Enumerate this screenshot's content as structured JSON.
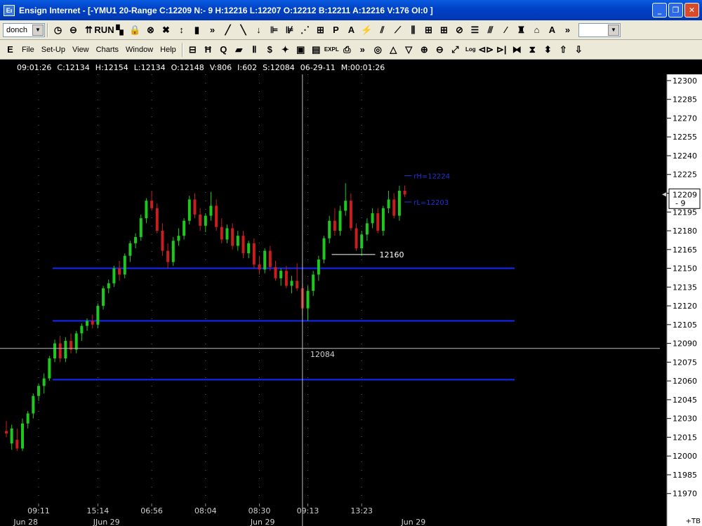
{
  "window": {
    "title": "Ensign Internet - [-YMU1 20-Range C:12209 N:- 9 H:12216 L:12207 O:12212 B:12211 A:12216 V:176 OI:0 ]",
    "minimize": "_",
    "maximize": "❐",
    "close": "✕"
  },
  "toolbar1": {
    "study_combo": "donch",
    "icons": [
      "◷",
      "⊖",
      "⇈",
      "RUN",
      "▚",
      "🔒",
      "⊗",
      "✖",
      "↕",
      "▮",
      "»",
      "╱",
      "╲",
      "↓",
      "⊫",
      "⊯",
      "⋰",
      "⊞",
      "P",
      "A",
      "⚡",
      "⫽",
      "⟋",
      "⫼",
      "⊞",
      "⊞",
      "⊘",
      "☰",
      "⫻",
      "⁄",
      "♜",
      "⌂",
      "A",
      "»"
    ],
    "right_combo": ""
  },
  "toolbar2": {
    "menus": [
      "File",
      "Set-Up",
      "View",
      "Charts",
      "Window",
      "Help"
    ],
    "icons": [
      "⊟",
      "Ħ",
      "Q",
      "▰",
      "Ⅱ",
      "$",
      "✦",
      "▣",
      "▤",
      "EXPL",
      "⎙",
      "»",
      "◎",
      "△",
      "▽",
      "⊕",
      "⊖",
      "⤢",
      "Log",
      "⊲⊳",
      "⊳|",
      "⧓",
      "⧗",
      "⬍",
      "⇧",
      "⇩"
    ]
  },
  "status": {
    "time": "09:01:26",
    "close": "C:12134",
    "high": "H:12154",
    "low": "L:12134",
    "open": "O:12148",
    "volume": "V:806",
    "interval": "I:602",
    "s": "S:12084",
    "date": "06-29-11",
    "m": "M:00:01:26"
  },
  "colors": {
    "up": "#1ec81e",
    "down": "#c81e1e",
    "hline": "#1428ff",
    "grid": "#6a6a6a",
    "label_blue": "#2233dd"
  },
  "chart_data": {
    "type": "candlestick",
    "title": "",
    "ylim": [
      11962,
      12305
    ],
    "y_ticks": [
      12300,
      12285,
      12270,
      12255,
      12240,
      12225,
      12210,
      12195,
      12180,
      12165,
      12150,
      12135,
      12120,
      12105,
      12090,
      12075,
      12060,
      12045,
      12030,
      12015,
      12000,
      11985,
      11970
    ],
    "x_ticks": [
      {
        "label": "09:11",
        "bar": 6
      },
      {
        "label": "15:14",
        "bar": 17
      },
      {
        "label": "06:56",
        "bar": 27
      },
      {
        "label": "08:04",
        "bar": 37
      },
      {
        "label": "08:30",
        "bar": 47
      },
      {
        "label": "09:13",
        "bar": 56
      },
      {
        "label": "13:23",
        "bar": 66
      }
    ],
    "date_labels": [
      {
        "label": "Jun 28",
        "bar": 4
      },
      {
        "label": "JJun 29",
        "bar": 19
      },
      {
        "label": "Jun 29",
        "bar": 48
      },
      {
        "label": "Jun 29",
        "bar": 76
      }
    ],
    "candles": [
      [
        12020,
        12028,
        12015,
        12018
      ],
      [
        12010,
        12025,
        12005,
        12022
      ],
      [
        12013,
        12022,
        12004,
        12006
      ],
      [
        12006,
        12030,
        12004,
        12026
      ],
      [
        12026,
        12036,
        12022,
        12034
      ],
      [
        12034,
        12050,
        12030,
        12048
      ],
      [
        12048,
        12058,
        12044,
        12056
      ],
      [
        12056,
        12066,
        12050,
        12062
      ],
      [
        12062,
        12080,
        12060,
        12078
      ],
      [
        12078,
        12093,
        12075,
        12090
      ],
      [
        12090,
        12096,
        12075,
        12078
      ],
      [
        12078,
        12095,
        12075,
        12092
      ],
      [
        12092,
        12098,
        12082,
        12085
      ],
      [
        12085,
        12100,
        12082,
        12098
      ],
      [
        12098,
        12106,
        12092,
        12104
      ],
      [
        12104,
        12110,
        12100,
        12108
      ],
      [
        12108,
        12113,
        12102,
        12105
      ],
      [
        12105,
        12122,
        12102,
        12120
      ],
      [
        12120,
        12136,
        12117,
        12134
      ],
      [
        12134,
        12141,
        12130,
        12138
      ],
      [
        12138,
        12152,
        12135,
        12150
      ],
      [
        12150,
        12156,
        12140,
        12145
      ],
      [
        12145,
        12162,
        12142,
        12160
      ],
      [
        12160,
        12172,
        12155,
        12170
      ],
      [
        12170,
        12178,
        12166,
        12175
      ],
      [
        12175,
        12193,
        12172,
        12190
      ],
      [
        12190,
        12206,
        12186,
        12204
      ],
      [
        12204,
        12212,
        12196,
        12198
      ],
      [
        12198,
        12202,
        12178,
        12180
      ],
      [
        12180,
        12186,
        12160,
        12164
      ],
      [
        12164,
        12170,
        12150,
        12155
      ],
      [
        12155,
        12175,
        12152,
        12172
      ],
      [
        12172,
        12182,
        12168,
        12176
      ],
      [
        12176,
        12190,
        12173,
        12188
      ],
      [
        12188,
        12208,
        12185,
        12205
      ],
      [
        12205,
        12210,
        12190,
        12193
      ],
      [
        12193,
        12198,
        12180,
        12184
      ],
      [
        12184,
        12194,
        12179,
        12192
      ],
      [
        12192,
        12211,
        12188,
        12200
      ],
      [
        12200,
        12205,
        12180,
        12183
      ],
      [
        12183,
        12190,
        12170,
        12173
      ],
      [
        12173,
        12185,
        12170,
        12182
      ],
      [
        12182,
        12186,
        12165,
        12168
      ],
      [
        12168,
        12180,
        12164,
        12176
      ],
      [
        12176,
        12180,
        12158,
        12162
      ],
      [
        12162,
        12172,
        12158,
        12170
      ],
      [
        12170,
        12174,
        12150,
        12153
      ],
      [
        12153,
        12160,
        12145,
        12149
      ],
      [
        12149,
        12166,
        12146,
        12164
      ],
      [
        12164,
        12168,
        12148,
        12151
      ],
      [
        12151,
        12156,
        12140,
        12142
      ],
      [
        12142,
        12150,
        12136,
        12148
      ],
      [
        12148,
        12152,
        12134,
        12136
      ],
      [
        12136,
        12144,
        12130,
        12140
      ],
      [
        12140,
        12154,
        12132,
        12134
      ],
      [
        12134,
        12138,
        12112,
        12118
      ],
      [
        12118,
        12136,
        12108,
        12132
      ],
      [
        12132,
        12148,
        12128,
        12145
      ],
      [
        12145,
        12160,
        12140,
        12157
      ],
      [
        12157,
        12176,
        12154,
        12174
      ],
      [
        12174,
        12192,
        12170,
        12188
      ],
      [
        12188,
        12198,
        12176,
        12180
      ],
      [
        12180,
        12200,
        12176,
        12196
      ],
      [
        12196,
        12218,
        12192,
        12204
      ],
      [
        12204,
        12210,
        12180,
        12182
      ],
      [
        12182,
        12186,
        12164,
        12166
      ],
      [
        12166,
        12180,
        12160,
        12177
      ],
      [
        12177,
        12190,
        12172,
        12186
      ],
      [
        12186,
        12198,
        12182,
        12194
      ],
      [
        12194,
        12198,
        12178,
        12180
      ],
      [
        12180,
        12200,
        12176,
        12198
      ],
      [
        12198,
        12212,
        12194,
        12205
      ],
      [
        12205,
        12210,
        12190,
        12192
      ],
      [
        12192,
        12216,
        12188,
        12212
      ],
      [
        12212,
        12216,
        12207,
        12209
      ]
    ],
    "horizontal_lines": [
      12150,
      12108,
      12061
    ],
    "crosshair": {
      "bar": 55,
      "price": 12086,
      "label": "12084"
    },
    "annotations": [
      {
        "text": "rH=12224",
        "price": 12224,
        "bar": 75,
        "color": "blue"
      },
      {
        "text": "rL=12203",
        "price": 12203,
        "bar": 75,
        "color": "blue"
      },
      {
        "text": "12160",
        "price": 12161,
        "bar": 68,
        "color": "white"
      }
    ],
    "price_marker": {
      "price": 12209,
      "text": "12209",
      "change": "- 9"
    },
    "corner_label": "+TB"
  }
}
